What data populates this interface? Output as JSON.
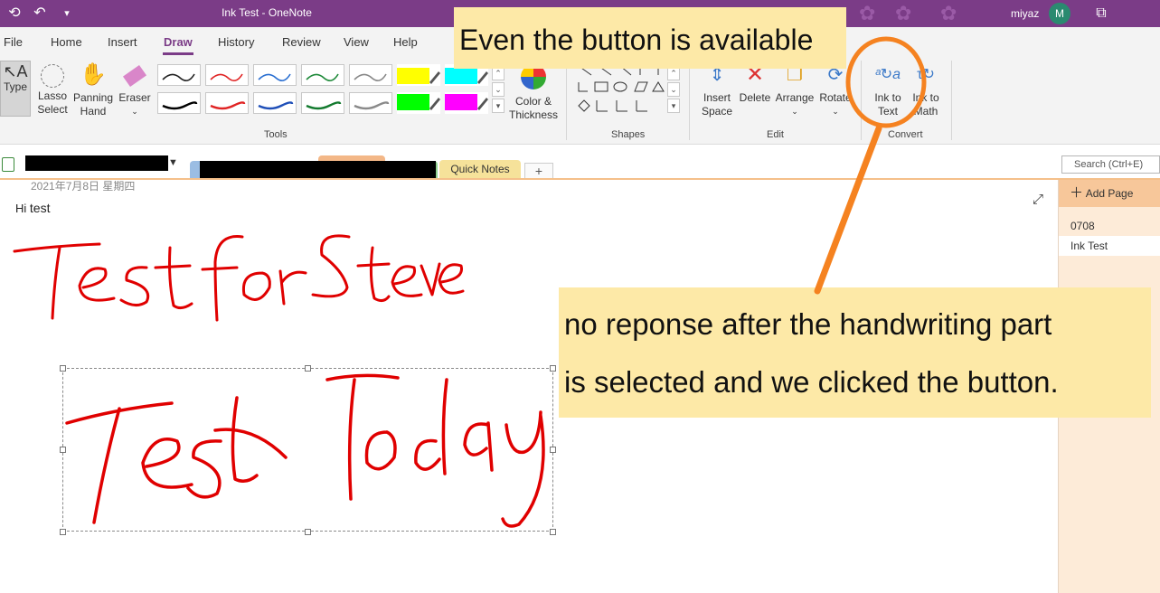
{
  "titlebar": {
    "title": "Ink Test - OneNote",
    "user": "miyaz",
    "avatar_initial": "M",
    "back_icon": "back-arrow-icon",
    "undo_icon": "undo-icon",
    "customize_icon": "chevron-down-icon",
    "restore_icon": "restore-window-icon",
    "accent": "#7b3c87"
  },
  "menu": {
    "items": [
      "File",
      "Home",
      "Insert",
      "Draw",
      "History",
      "Review",
      "View",
      "Help"
    ],
    "active": "Draw"
  },
  "ribbon": {
    "type": "Type",
    "lasso": "Lasso Select",
    "lasso_l1": "Lasso",
    "lasso_l2": "Select",
    "panning_l1": "Panning",
    "panning_l2": "Hand",
    "eraser": "Eraser",
    "color_l1": "Color &",
    "color_l2": "Thickness",
    "insert_space_l1": "Insert",
    "insert_space_l2": "Space",
    "delete": "Delete",
    "arrange": "Arrange",
    "rotate": "Rotate",
    "ink_to_text_l1": "Ink to",
    "ink_to_text_l2": "Text",
    "ink_to_math_l1": "Ink to",
    "ink_to_math_l2": "Math",
    "groups": {
      "tools": "Tools",
      "shapes": "Shapes",
      "edit": "Edit",
      "convert": "Convert"
    },
    "pen_colors": [
      "#222222",
      "#e02424",
      "#2a6fd1",
      "#1f8a3a",
      "#888888",
      "#ffff00",
      "#00ffff",
      "#000000",
      "#e02424",
      "#1f4fb8",
      "#137a2e",
      "#8a8a8a",
      "#00ff00",
      "#ff00ff"
    ]
  },
  "notebook": {
    "quick_notes": "Quick Notes",
    "add_tab": "+",
    "search_placeholder": "Search (Ctrl+E)"
  },
  "pages": {
    "add_page": "Add Page",
    "items": [
      "0708",
      "Ink Test"
    ],
    "selected": "Ink Test"
  },
  "note": {
    "date": "2021年7月8日 星期四",
    "hi": "Hi",
    "test": "test",
    "ink_line1": "Test for Steve",
    "ink_line2": "Test Today",
    "ink_color": "#e00000"
  },
  "callouts": {
    "top": "Even the button is available",
    "bottom_line1": "no reponse after the handwriting part",
    "bottom_line2": "is selected and we clicked the button.",
    "bg": "#fde9a7",
    "arrow_color": "#f58220"
  }
}
